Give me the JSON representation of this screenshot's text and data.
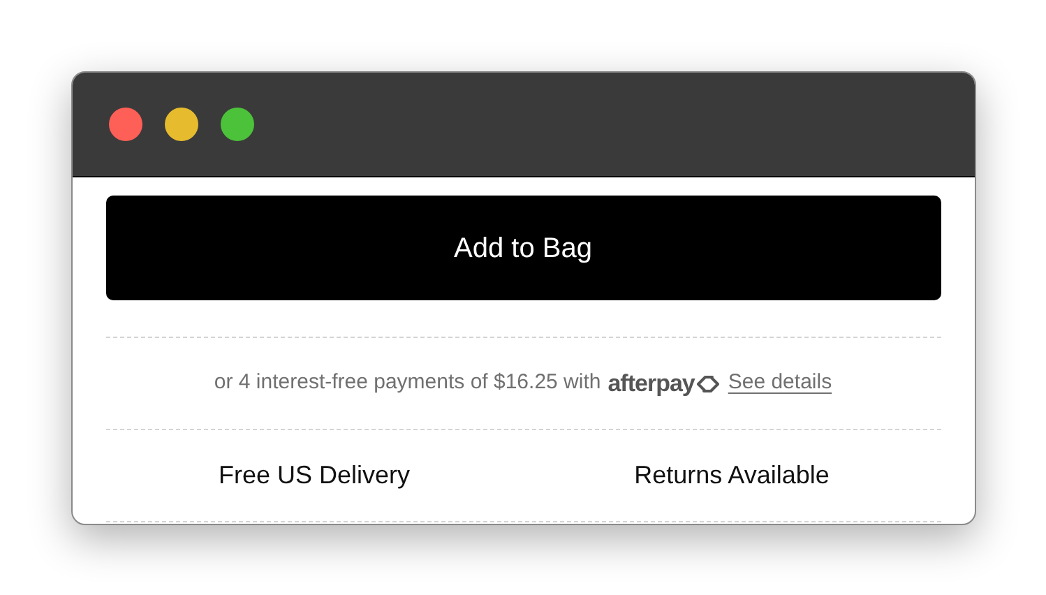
{
  "button": {
    "label": "Add to Bag"
  },
  "payment": {
    "text": "or 4 interest-free payments of $16.25 with",
    "brand": "afterpay",
    "link": "See details"
  },
  "features": [
    "Free US Delivery",
    "Returns Available"
  ]
}
